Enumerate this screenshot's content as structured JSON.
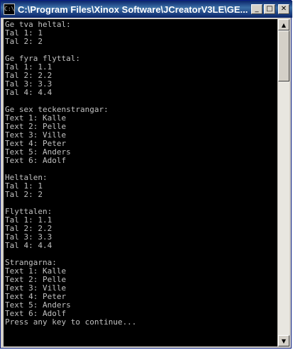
{
  "window": {
    "title": "C:\\Program Files\\Xinox Software\\JCreatorV3LE\\GE...",
    "icon_text": "C:\\"
  },
  "caption_buttons": {
    "minimize": "_",
    "maximize": "□",
    "close": "✕"
  },
  "console": {
    "lines": [
      "Ge tva heltal:",
      "Tal 1: 1",
      "Tal 2: 2",
      "",
      "Ge fyra flyttal:",
      "Tal 1: 1.1",
      "Tal 2: 2.2",
      "Tal 3: 3.3",
      "Tal 4: 4.4",
      "",
      "Ge sex teckenstrangar:",
      "Text 1: Kalle",
      "Text 2: Pelle",
      "Text 3: Ville",
      "Text 4: Peter",
      "Text 5: Anders",
      "Text 6: Adolf",
      "",
      "Heltalen:",
      "Tal 1: 1",
      "Tal 2: 2",
      "",
      "Flyttalen:",
      "Tal 1: 1.1",
      "Tal 2: 2.2",
      "Tal 3: 3.3",
      "Tal 4: 4.4",
      "",
      "Strangarna:",
      "Text 1: Kalle",
      "Text 2: Pelle",
      "Text 3: Ville",
      "Text 4: Peter",
      "Text 5: Anders",
      "Text 6: Adolf",
      "Press any key to continue..."
    ]
  },
  "scrollbar": {
    "up_arrow": "▲",
    "down_arrow": "▼",
    "position": 0
  },
  "colors": {
    "console_background": "#000000",
    "console_text": "#c0c0c0",
    "titlebar_start": "#0a246a",
    "titlebar_end": "#3a6ea5"
  }
}
